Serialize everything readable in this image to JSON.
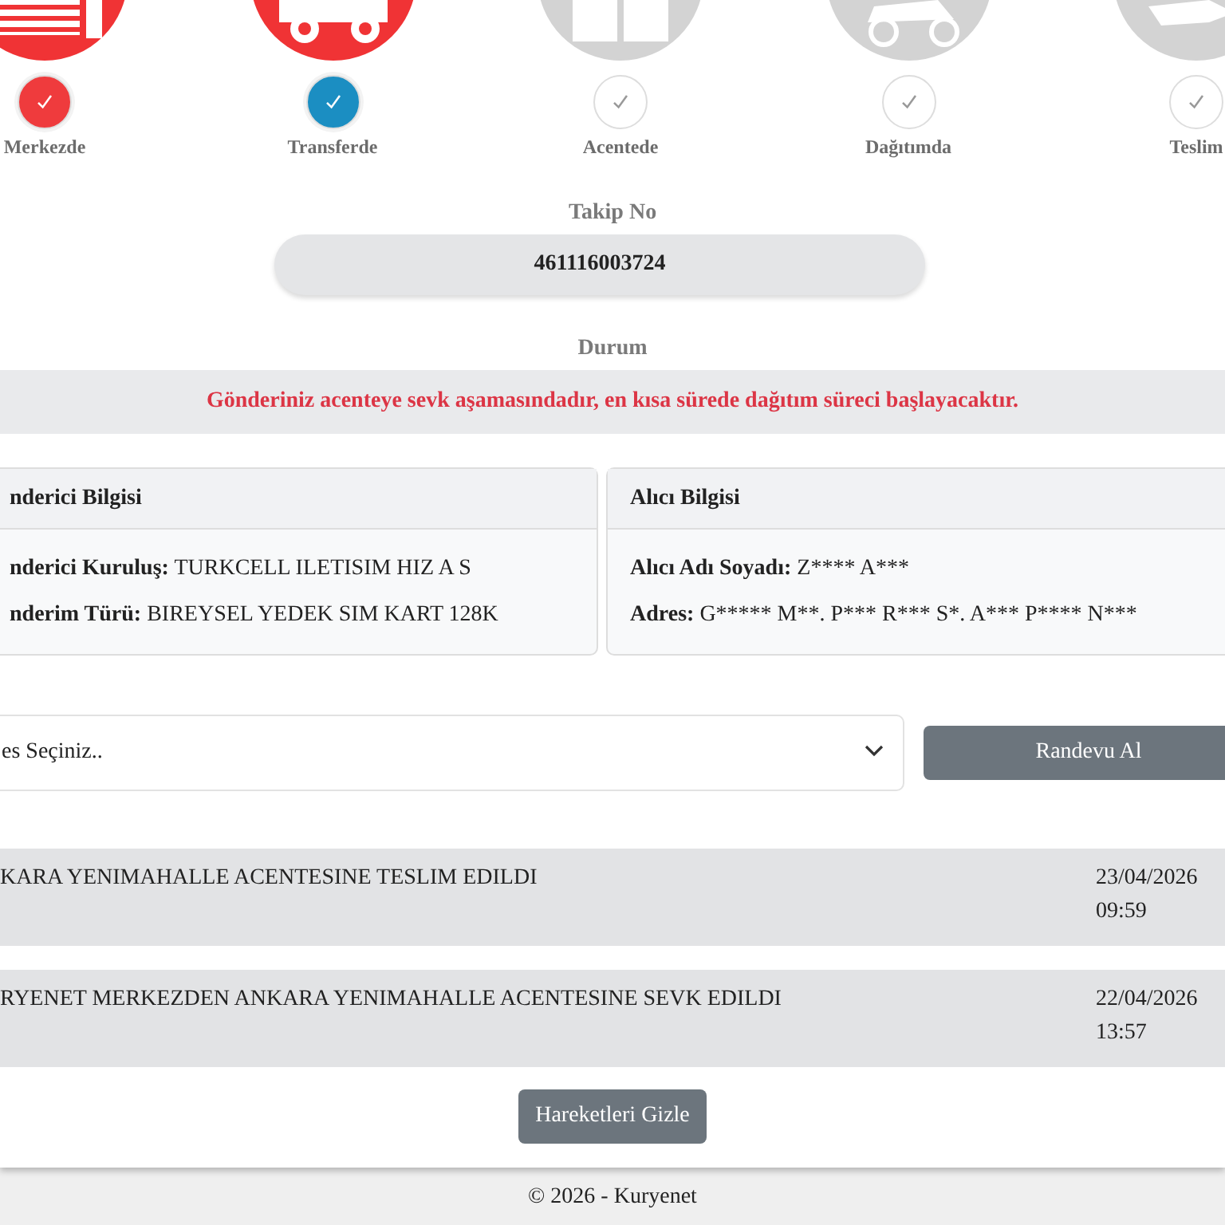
{
  "steps": [
    {
      "label": "Merkezde",
      "completed": true,
      "current": false
    },
    {
      "label": "Transferde",
      "completed": true,
      "current": true
    },
    {
      "label": "Acentede",
      "completed": false,
      "current": false
    },
    {
      "label": "Dağıtımda",
      "completed": false,
      "current": false
    },
    {
      "label": "Teslim",
      "completed": false,
      "current": false
    }
  ],
  "tracking": {
    "label": "Takip No",
    "value": "461116003724"
  },
  "status": {
    "label": "Durum",
    "message": "Gönderiniz acenteye sevk aşamasındadır, en kısa sürede dağıtım süreci başlayacaktır."
  },
  "cards": [
    {
      "title": "nderici Bilgisi",
      "fields": [
        {
          "label": "nderici Kuruluş:",
          "value": "TURKCELL ILETISIM HIZ A S"
        },
        {
          "label": "nderim Türü:",
          "value": "BIREYSEL YEDEK SIM KART 128K"
        }
      ]
    },
    {
      "title": "Alıcı Bilgisi",
      "fields": [
        {
          "label": "Alıcı Adı Soyadı:",
          "value": "Z**** A***"
        },
        {
          "label": "Adres:",
          "value": "G***** M**. P*** R*** S*. A*** P**** N***"
        }
      ]
    }
  ],
  "appointment": {
    "select_value": "es Seçiniz..",
    "button": "Randevu Al"
  },
  "movements": [
    {
      "text": "KARA YENIMAHALLE ACENTESINE TESLIM EDILDI",
      "date": "23/04/2026",
      "time": "09:59"
    },
    {
      "text": "RYENET MERKEZDEN ANKARA YENIMAHALLE ACENTESINE SEVK EDILDI",
      "date": "22/04/2026",
      "time": "13:57"
    }
  ],
  "hide_button": "Hareketleri Gizle",
  "footer": "© 2026 - Kuryenet"
}
